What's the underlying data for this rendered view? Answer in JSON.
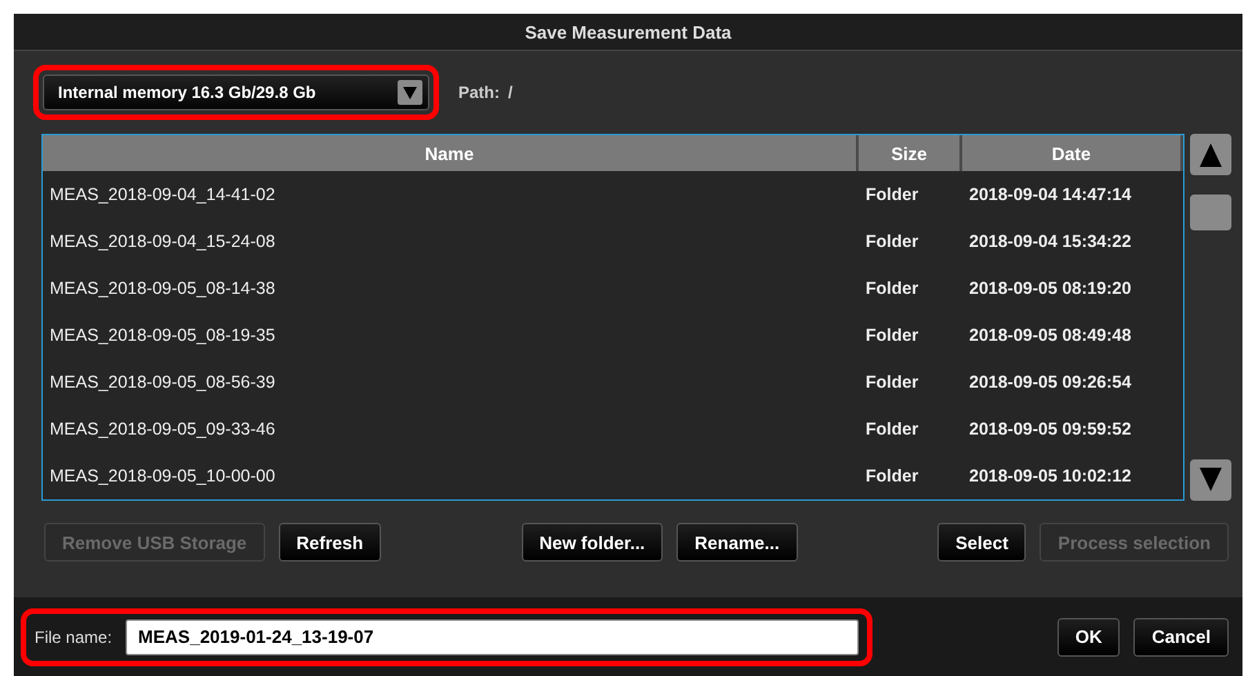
{
  "window": {
    "title": "Save Measurement Data"
  },
  "storage": {
    "value": "Internal memory 16.3 Gb/29.8 Gb",
    "highlighted": true
  },
  "path": {
    "label": "Path:",
    "value": "/"
  },
  "table": {
    "columns": [
      "Name",
      "Size",
      "Date"
    ],
    "rows": [
      {
        "name": "MEAS_2018-09-04_14-41-02",
        "size": "Folder",
        "date": "2018-09-04 14:47:14"
      },
      {
        "name": "MEAS_2018-09-04_15-24-08",
        "size": "Folder",
        "date": "2018-09-04 15:34:22"
      },
      {
        "name": "MEAS_2018-09-05_08-14-38",
        "size": "Folder",
        "date": "2018-09-05 08:19:20"
      },
      {
        "name": "MEAS_2018-09-05_08-19-35",
        "size": "Folder",
        "date": "2018-09-05 08:49:48"
      },
      {
        "name": "MEAS_2018-09-05_08-56-39",
        "size": "Folder",
        "date": "2018-09-05 09:26:54"
      },
      {
        "name": "MEAS_2018-09-05_09-33-46",
        "size": "Folder",
        "date": "2018-09-05 09:59:52"
      },
      {
        "name": "MEAS_2018-09-05_10-00-00",
        "size": "Folder",
        "date": "2018-09-05 10:02:12"
      }
    ]
  },
  "action_groups": [
    [
      {
        "label": "Remove USB Storage",
        "disabled": true
      },
      {
        "label": "Refresh",
        "disabled": false
      }
    ],
    [
      {
        "label": "New folder...",
        "disabled": false
      },
      {
        "label": "Rename...",
        "disabled": false
      }
    ],
    [
      {
        "label": "Select",
        "disabled": false
      },
      {
        "label": "Process selection",
        "disabled": true
      }
    ]
  ],
  "file_name": {
    "label": "File name:",
    "value": "MEAS_2019-01-24_13-19-07",
    "highlighted": true
  },
  "buttons": [
    "OK",
    "Cancel"
  ]
}
